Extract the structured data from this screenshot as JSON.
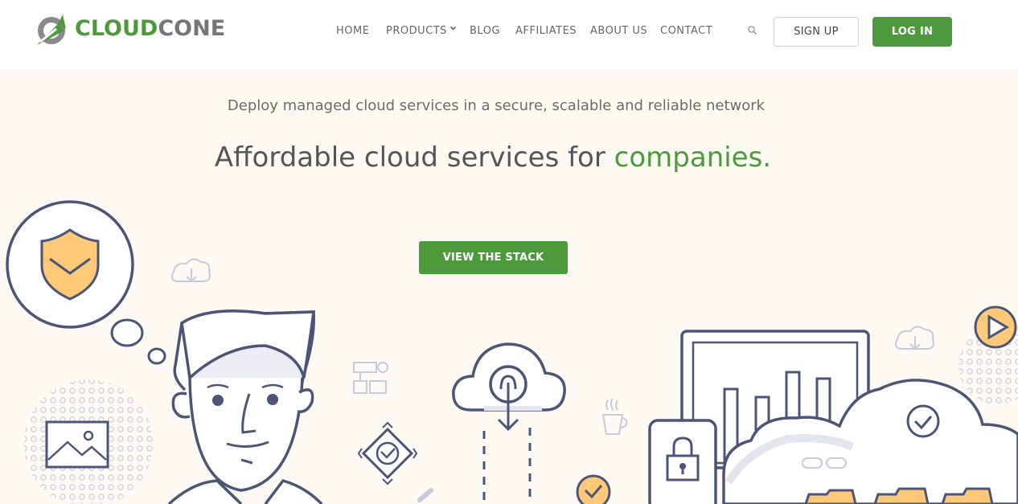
{
  "brand": {
    "logo_part1": "CLOUD",
    "logo_part2": "CONE"
  },
  "nav": {
    "home": "HOME",
    "products": "PRODUCTS",
    "blog": "BLOG",
    "affiliates": "AFFILIATES",
    "about": "ABOUT US",
    "contact": "CONTACT"
  },
  "header_actions": {
    "signup": "SIGN UP",
    "login": "LOG IN",
    "search_icon": "search-icon"
  },
  "hero": {
    "subtitle": "Deploy managed cloud services in a secure, scalable and reliable network",
    "headline_prefix": "Affordable cloud services for ",
    "headline_accent": "companies.",
    "cta": "VIEW THE STACK"
  },
  "colors": {
    "brand_green": "#4c9a3c",
    "line_navy": "#4a5578",
    "accent_orange": "#ffc978",
    "background": "#fdfaf3"
  }
}
